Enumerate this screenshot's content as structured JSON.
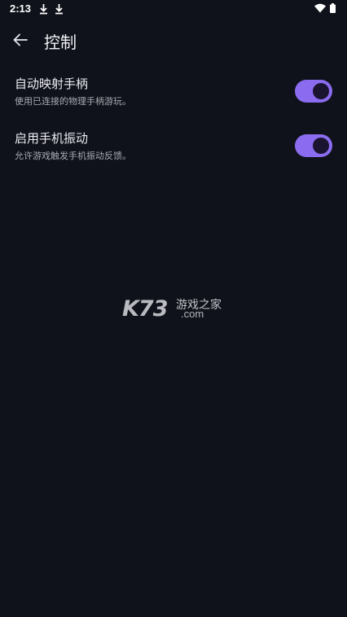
{
  "status_bar": {
    "time": "2:13",
    "icons": [
      "download-icon",
      "download-icon",
      "wifi-icon",
      "battery-icon"
    ]
  },
  "header": {
    "back_icon": "arrow-left-icon",
    "title": "控制"
  },
  "settings": [
    {
      "title": "自动映射手柄",
      "description": "使用已连接的物理手柄游玩。",
      "enabled": true
    },
    {
      "title": "启用手机振动",
      "description": "允许游戏触发手机振动反馈。",
      "enabled": true
    }
  ],
  "watermark": {
    "logo": "K73",
    "text": "游戏之家",
    "domain": ".com"
  },
  "colors": {
    "background": "#0f121a",
    "accent": "#8b6cf0",
    "text_primary": "#ececf2",
    "text_secondary": "#a9aab3"
  }
}
